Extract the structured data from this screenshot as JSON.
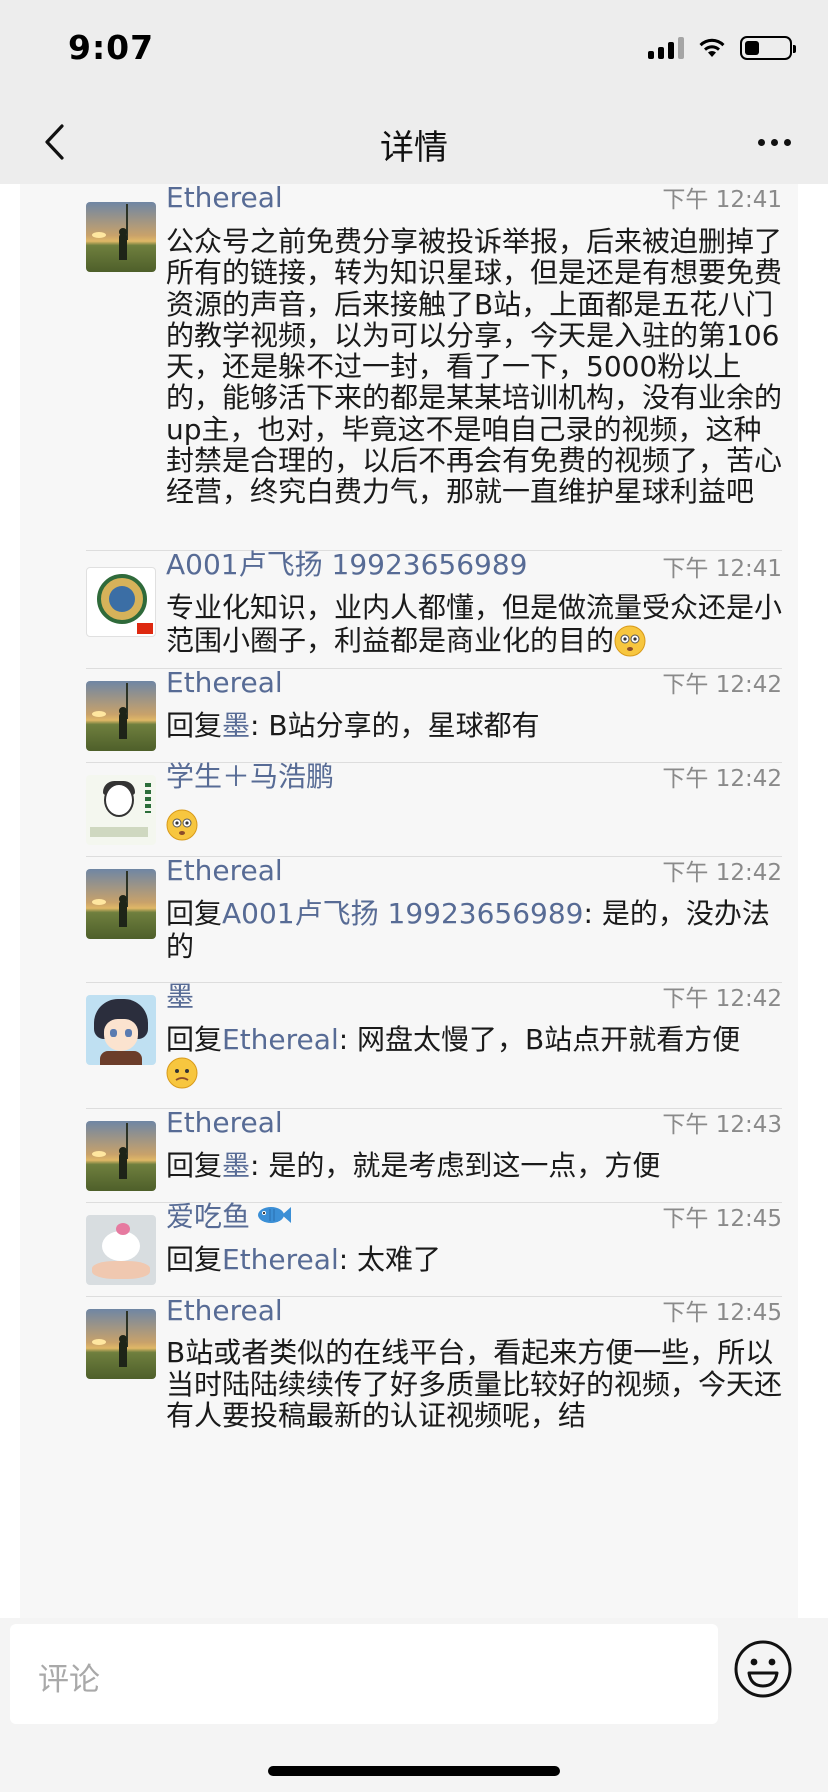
{
  "status_bar": {
    "time": "9:07"
  },
  "nav": {
    "title": "详情"
  },
  "comments": [
    {
      "name": "Ethereal",
      "time": "下午 12:41",
      "avatar": "sunset-silhouette",
      "text": "公众号之前免费分享被投诉举报，后来被迫删掉了所有的链接，转为知识星球，但是还是有想要免费资源的声音，后来接触了B站，上面都是五花八门的教学视频，以为可以分享，今天是入驻的第106天，还是躲不过一封，看了一下，5000粉以上的，能够活下来的都是某某培训机构，没有业余的up主，也对，毕竟这不是咱自己录的视频，这种封禁是合理的，以后不再会有免费的视频了，苦心经营，终究白费力气，那就一直维护星球利益吧"
    },
    {
      "name": "A001卢飞扬 19923656989",
      "time": "下午 12:41",
      "avatar": "circular-badge",
      "text": "专业化知识，业内人都懂，但是做流量受众还是小范围小圈子，利益都是商业化的目的",
      "emoji": "flushed-face"
    },
    {
      "name": "Ethereal",
      "time": "下午 12:42",
      "avatar": "sunset-silhouette",
      "reply_label": "回复",
      "reply_to": "墨",
      "text": ": B站分享的，星球都有"
    },
    {
      "name": "学生＋马浩鹏",
      "time": "下午 12:42",
      "avatar": "student-drawing",
      "emoji": "flushed-face"
    },
    {
      "name": "Ethereal",
      "time": "下午 12:42",
      "avatar": "sunset-silhouette",
      "reply_label": "回复",
      "reply_to": "A001卢飞扬 19923656989",
      "text": ": 是的，没办法的"
    },
    {
      "name": "墨",
      "time": "下午 12:42",
      "avatar": "anime-boy",
      "reply_label": "回复",
      "reply_to": "Ethereal",
      "text": ": 网盘太慢了，B站点开就看方便",
      "emoji": "worried-face"
    },
    {
      "name": "Ethereal",
      "time": "下午 12:43",
      "avatar": "sunset-silhouette",
      "reply_label": "回复",
      "reply_to": "墨",
      "text": ": 是的，就是考虑到这一点，方便"
    },
    {
      "name": "爱吃鱼",
      "name_icon": "fish-icon",
      "time": "下午 12:45",
      "avatar": "bird-on-hand",
      "reply_label": "回复",
      "reply_to": "Ethereal",
      "text": ": 太难了"
    },
    {
      "name": "Ethereal",
      "time": "下午 12:45",
      "avatar": "sunset-silhouette",
      "text": "B站或者类似的在线平台，看起来方便一些，所以当时陆陆续续传了好多质量比较好的视频，今天还有人要投稿最新的认证视频呢，结"
    }
  ],
  "input": {
    "placeholder": "评论"
  },
  "colors": {
    "link": "#576b95",
    "time": "#8a8a8a",
    "background": "#f7f7f7",
    "bar": "#ededed"
  }
}
